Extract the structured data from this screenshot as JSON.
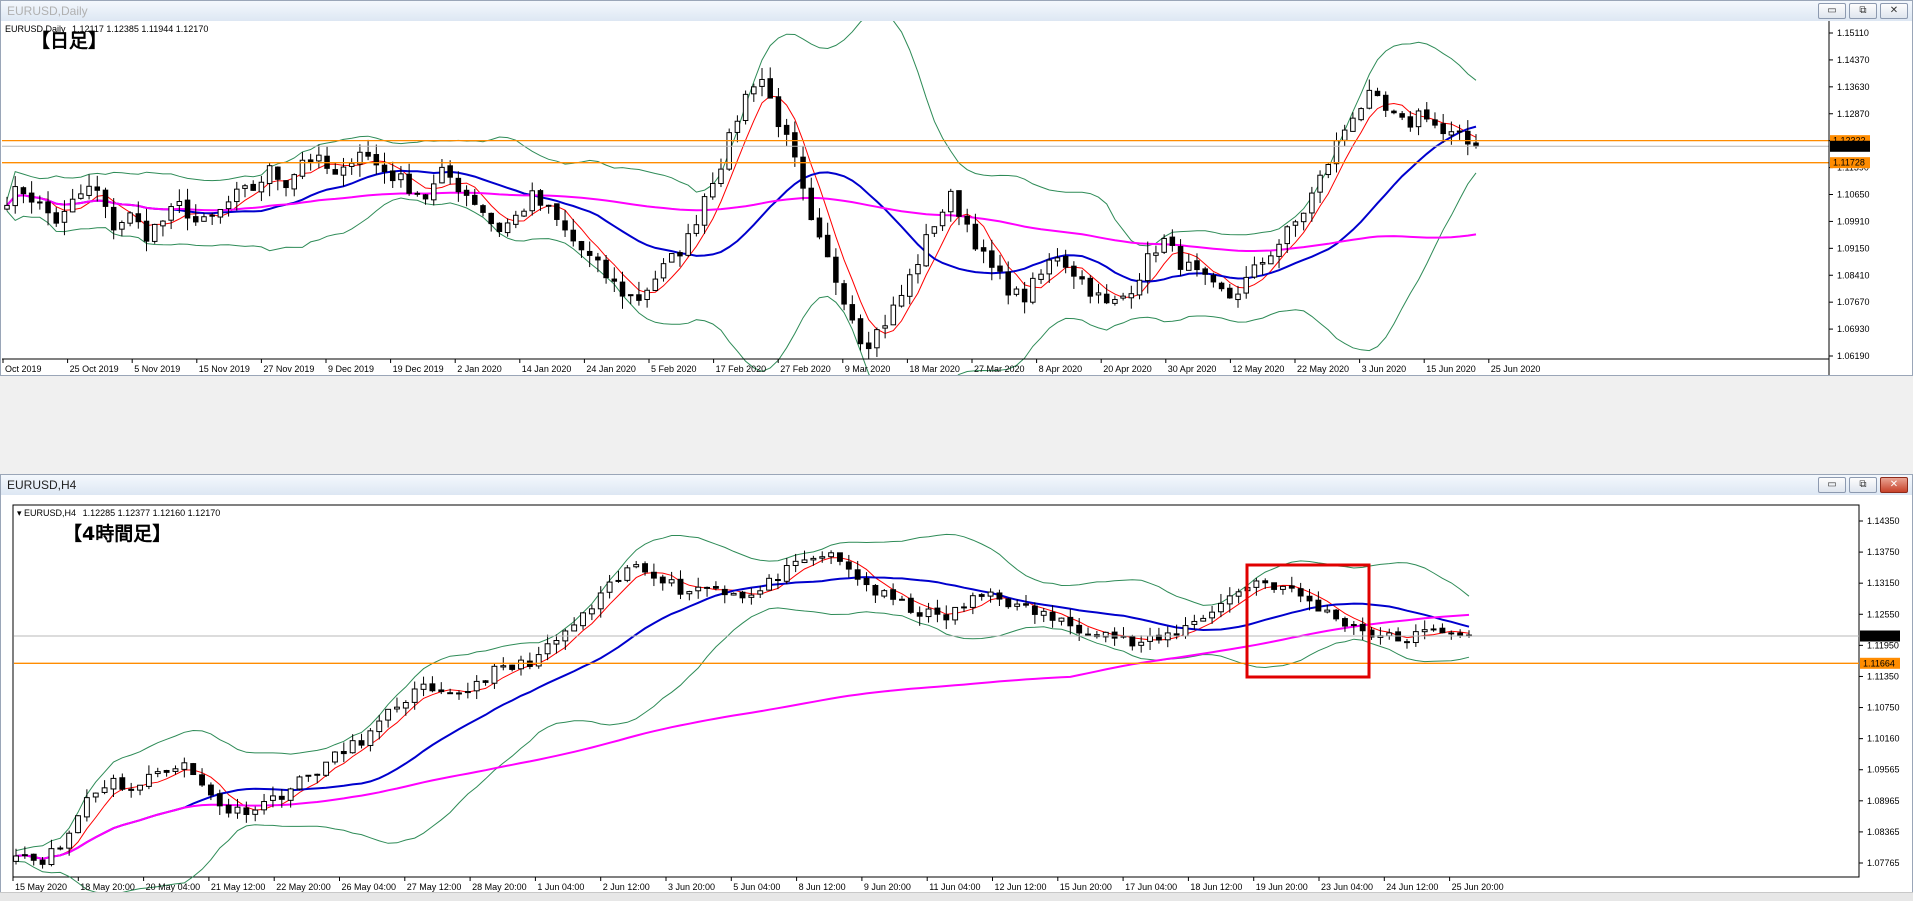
{
  "window1": {
    "title": "EURUSD,Daily",
    "symbol_line": "EURUSD,Daily",
    "ohlc_line": "1.12117 1.12385 1.11944 1.12170",
    "label": "【日足】",
    "y_ticks": [
      "1.15110",
      "1.14370",
      "1.13630",
      "1.12870",
      "1.12170",
      "1.11390",
      "1.10650",
      "1.09910",
      "1.09150",
      "1.08410",
      "1.07670",
      "1.06930",
      "1.06190"
    ],
    "x_ticks": [
      "Oct 2019",
      "25 Oct 2019",
      "5 Nov 2019",
      "15 Nov 2019",
      "27 Nov 2019",
      "9 Dec 2019",
      "19 Dec 2019",
      "2 Jan 2020",
      "14 Jan 2020",
      "24 Jan 2020",
      "5 Feb 2020",
      "17 Feb 2020",
      "27 Feb 2020",
      "9 Mar 2020",
      "18 Mar 2020",
      "27 Mar 2020",
      "8 Apr 2020",
      "20 Apr 2020",
      "30 Apr 2020",
      "12 May 2020",
      "22 May 2020",
      "3 Jun 2020",
      "15 Jun 2020",
      "25 Jun 2020"
    ],
    "price_labels": [
      {
        "text": "1.12322",
        "color": "#ff8c00"
      },
      {
        "text": "1.12170",
        "color": "#000000"
      },
      {
        "text": "1.11728",
        "color": "#ff8c00"
      }
    ]
  },
  "window2": {
    "title": "EURUSD,H4",
    "symbol_line": "EURUSD,H4",
    "ohlc_line": "1.12285 1.12377 1.12160 1.12170",
    "label": "【4時間足】",
    "y_ticks": [
      "1.14350",
      "1.13750",
      "1.13150",
      "1.12550",
      "1.11950",
      "1.11350",
      "1.10750",
      "1.10160",
      "1.09565",
      "1.08965",
      "1.08365",
      "1.07765"
    ],
    "x_ticks": [
      "15 May 2020",
      "18 May 20:00",
      "20 May 04:00",
      "21 May 12:00",
      "22 May 20:00",
      "26 May 04:00",
      "27 May 12:00",
      "28 May 20:00",
      "1 Jun 04:00",
      "2 Jun 12:00",
      "3 Jun 20:00",
      "5 Jun 04:00",
      "8 Jun 12:00",
      "9 Jun 20:00",
      "11 Jun 04:00",
      "12 Jun 12:00",
      "15 Jun 20:00",
      "17 Jun 04:00",
      "18 Jun 12:00",
      "19 Jun 20:00",
      "23 Jun 04:00",
      "24 Jun 12:00",
      "25 Jun 20:00"
    ],
    "price_labels": [
      {
        "text": "1.12170",
        "color": "#000000"
      },
      {
        "text": "1.11664",
        "color": "#ff8c00"
      }
    ]
  },
  "buttons": {
    "minimize": "▭",
    "restore": "⧉",
    "close": "✕"
  },
  "colors": {
    "candle": "#000000",
    "ma_fast": "#ff0000",
    "ma_mid": "#0000cd",
    "ma_slow": "#ff00ff",
    "bollinger": "#2e8b57",
    "hline": "#ff8c00",
    "highlight_box": "#e00000"
  },
  "chart_data": [
    {
      "type": "candlestick",
      "name": "EURUSD Daily",
      "ylim": [
        1.06,
        1.1555
      ],
      "x_range": [
        "Oct 2019",
        "25 Jun 2020"
      ],
      "horizontal_lines": [
        1.12322,
        1.11728
      ],
      "current_price": 1.1217,
      "indicators": [
        "moving average (red)",
        "moving average (blue)",
        "moving average (magenta)",
        "Bollinger Bands (green)"
      ],
      "close_path": [
        1.108,
        1.11,
        1.105,
        1.101,
        1.108,
        1.111,
        1.1,
        1.103,
        1.098,
        1.102,
        1.106,
        1.1,
        1.103,
        1.108,
        1.11,
        1.115,
        1.112,
        1.119,
        1.117,
        1.112,
        1.122,
        1.117,
        1.114,
        1.111,
        1.108,
        1.115,
        1.11,
        1.106,
        1.099,
        1.102,
        1.108,
        1.104,
        1.098,
        1.093,
        1.088,
        1.083,
        1.08,
        1.086,
        1.091,
        1.097,
        1.11,
        1.119,
        1.133,
        1.142,
        1.13,
        1.118,
        1.1,
        1.09,
        1.08,
        1.068,
        1.073,
        1.08,
        1.09,
        1.101,
        1.108,
        1.1,
        1.09,
        1.085,
        1.08,
        1.086,
        1.093,
        1.088,
        1.083,
        1.078,
        1.082,
        1.089,
        1.097,
        1.091,
        1.087,
        1.083,
        1.081,
        1.086,
        1.092,
        1.097,
        1.103,
        1.112,
        1.122,
        1.131,
        1.135,
        1.13,
        1.127,
        1.132,
        1.125,
        1.124,
        1.121
      ]
    },
    {
      "type": "candlestick",
      "name": "EURUSD H4",
      "ylim": [
        1.077,
        1.146
      ],
      "x_range": [
        "15 May 2020",
        "25 Jun 2020"
      ],
      "horizontal_lines": [
        1.11664
      ],
      "current_price": 1.1217,
      "highlighted_region": {
        "from": "19 Jun 20:00",
        "to": "24 Jun 12:00"
      },
      "indicators": [
        "moving average (red)",
        "moving average (blue)",
        "moving average (magenta)",
        "Bollinger Bands (green)"
      ],
      "close_path": [
        1.082,
        1.08,
        1.083,
        1.092,
        1.095,
        1.093,
        1.097,
        1.098,
        1.093,
        1.089,
        1.09,
        1.092,
        1.095,
        1.098,
        1.101,
        1.104,
        1.109,
        1.112,
        1.11,
        1.112,
        1.115,
        1.116,
        1.118,
        1.122,
        1.126,
        1.131,
        1.135,
        1.133,
        1.13,
        1.131,
        1.13,
        1.129,
        1.133,
        1.135,
        1.137,
        1.134,
        1.13,
        1.128,
        1.126,
        1.125,
        1.128,
        1.13,
        1.127,
        1.126,
        1.124,
        1.123,
        1.122,
        1.12,
        1.121,
        1.123,
        1.126,
        1.129,
        1.132,
        1.131,
        1.129,
        1.126,
        1.124,
        1.122,
        1.121,
        1.122,
        1.123,
        1.122
      ]
    }
  ]
}
